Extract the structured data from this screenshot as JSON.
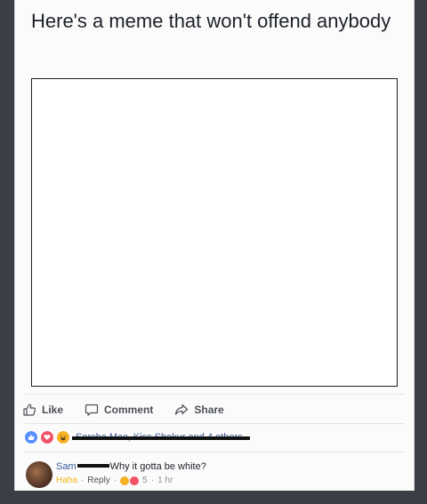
{
  "post": {
    "text": "Here's a meme that won't offend anybody"
  },
  "actions": {
    "like_label": "Like",
    "comment_label": "Comment",
    "share_label": "Share"
  },
  "reactions_summary": {
    "text": "Sorcha Mac, Kiss Shakur and 4 others"
  },
  "comment": {
    "author_first": "Sam",
    "text": "Why it gotta be white?",
    "reaction_label": "Haha",
    "reply_label": "Reply",
    "reaction_count": "5",
    "timestamp": "1 hr"
  },
  "colors": {
    "page_background": "#3b3e44",
    "card_background": "#fbfbfb",
    "link": "#365899",
    "haha": "#f0ba15",
    "like_reaction": "#5890ff",
    "love_reaction": "#f25268"
  },
  "icons": [
    "thumbs-up-icon",
    "comment-bubble-icon",
    "share-arrow-icon",
    "like-reaction-icon",
    "love-reaction-icon",
    "haha-reaction-icon"
  ]
}
